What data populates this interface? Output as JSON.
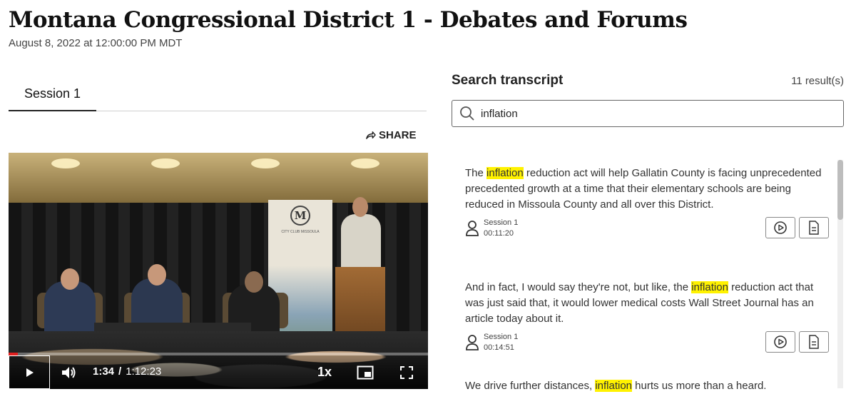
{
  "page": {
    "title": "Montana Congressional District 1 - Debates and Forums",
    "date": "August 8, 2022 at 12:00:00 PM MDT"
  },
  "tabs": [
    {
      "label": "Session 1",
      "active": true
    }
  ],
  "share_label": "SHARE",
  "player": {
    "current_time": "1:34",
    "separator": "/",
    "duration": "1:12:23",
    "speed": "1x",
    "progress": 0.022,
    "banner_letter": "M",
    "banner_text": "CITY CLUB MISSOULA"
  },
  "search": {
    "title": "Search transcript",
    "result_count": "11 result(s)",
    "query": "inflation"
  },
  "results": [
    {
      "before": "The ",
      "match": "inflation",
      "after": " reduction act will help Gallatin County is facing unprecedented precedented growth at a time that their elementary schools are being reduced in Missoula County and all over this District.",
      "session": "Session 1",
      "time": "00:11:20"
    },
    {
      "before": "And in fact, I would say they're not, but like, the ",
      "match": "inflation",
      "after": " reduction act that was just said that, it would lower medical costs Wall Street Journal has an article today about it.",
      "session": "Session 1",
      "time": "00:14:51"
    },
    {
      "before": "We drive further distances, ",
      "match": "inflation",
      "after": " hurts us more than a heard.",
      "session": "",
      "time": ""
    }
  ],
  "icons": {
    "share": "share-arrow-icon",
    "search": "search-icon",
    "person": "person-icon",
    "play_clip": "play-circle-icon",
    "transcript": "document-icon"
  },
  "colors": {
    "highlight": "#fff200",
    "progress": "#e02020"
  }
}
